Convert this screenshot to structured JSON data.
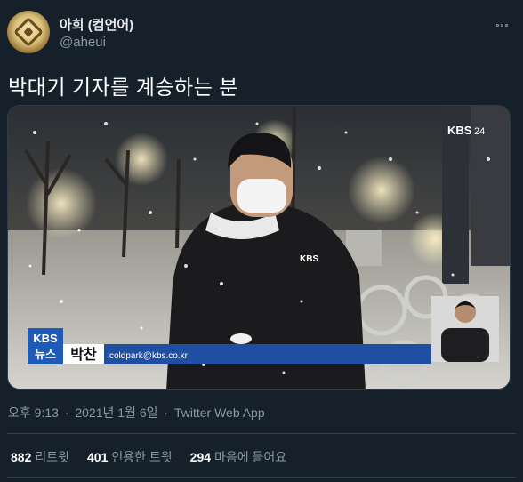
{
  "user": {
    "name": "아희 (컴언어)",
    "handle": "@aheui"
  },
  "tweet": {
    "text": "박대기 기자를 계승하는 분"
  },
  "media": {
    "logo_top": "KBS",
    "logo_top_suffix": "24",
    "chyron_brand_line1": "KBS",
    "chyron_brand_line2": "뉴스",
    "chyron_name": "박찬",
    "chyron_email": "coldpark@kbs.co.kr",
    "jacket_logo": "KBS",
    "colors": {
      "chyron_brand": "#1c5cb8",
      "chyron_bar": "#1f4fa3"
    }
  },
  "meta": {
    "time": "오후 9:13",
    "sep1": "·",
    "date": "2021년 1월 6일",
    "sep2": "·",
    "source": "Twitter Web App"
  },
  "stats": {
    "retweets_count": "882",
    "retweets_label": "리트윗",
    "quotes_count": "401",
    "quotes_label": "인용한 트윗",
    "likes_count": "294",
    "likes_label": "마음에 들어요"
  }
}
